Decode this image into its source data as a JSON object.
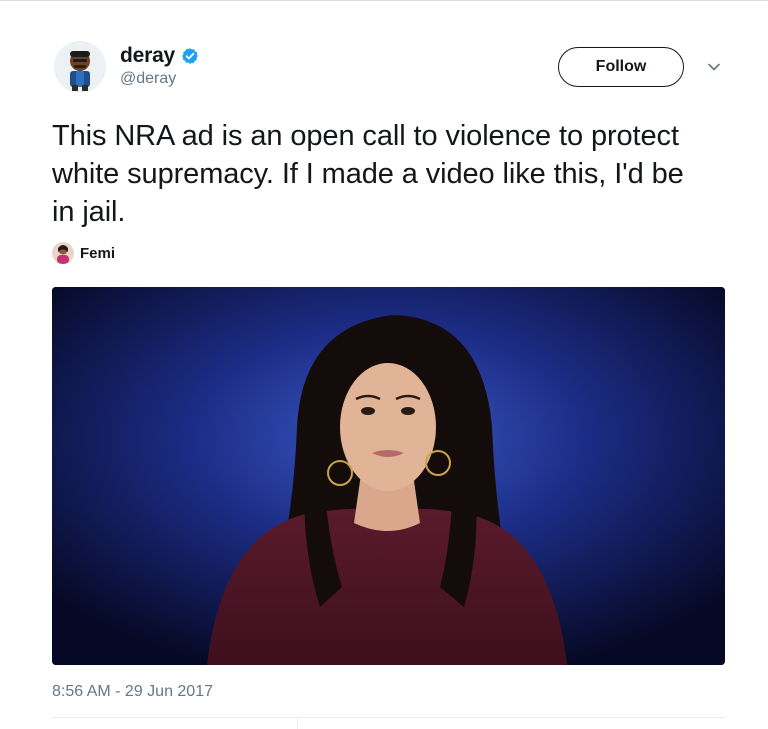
{
  "tweet": {
    "author": {
      "display_name": "deray",
      "handle": "@deray",
      "verified": true
    },
    "follow_label": "Follow",
    "text": "This NRA ad is an open call to violence to protect white supremacy. If I made a video like this, I'd be in jail.",
    "tagged_user": "Femi",
    "timestamp": "8:56 AM - 29 Jun 2017"
  },
  "icons": {
    "verified": "verified-badge-icon",
    "caret": "chevron-down-icon"
  },
  "colors": {
    "verified_blue": "#1da1f2",
    "text_primary": "#14171a",
    "text_secondary": "#657786",
    "follow_border": "#14171a",
    "video_background": "#0a0f3a"
  }
}
